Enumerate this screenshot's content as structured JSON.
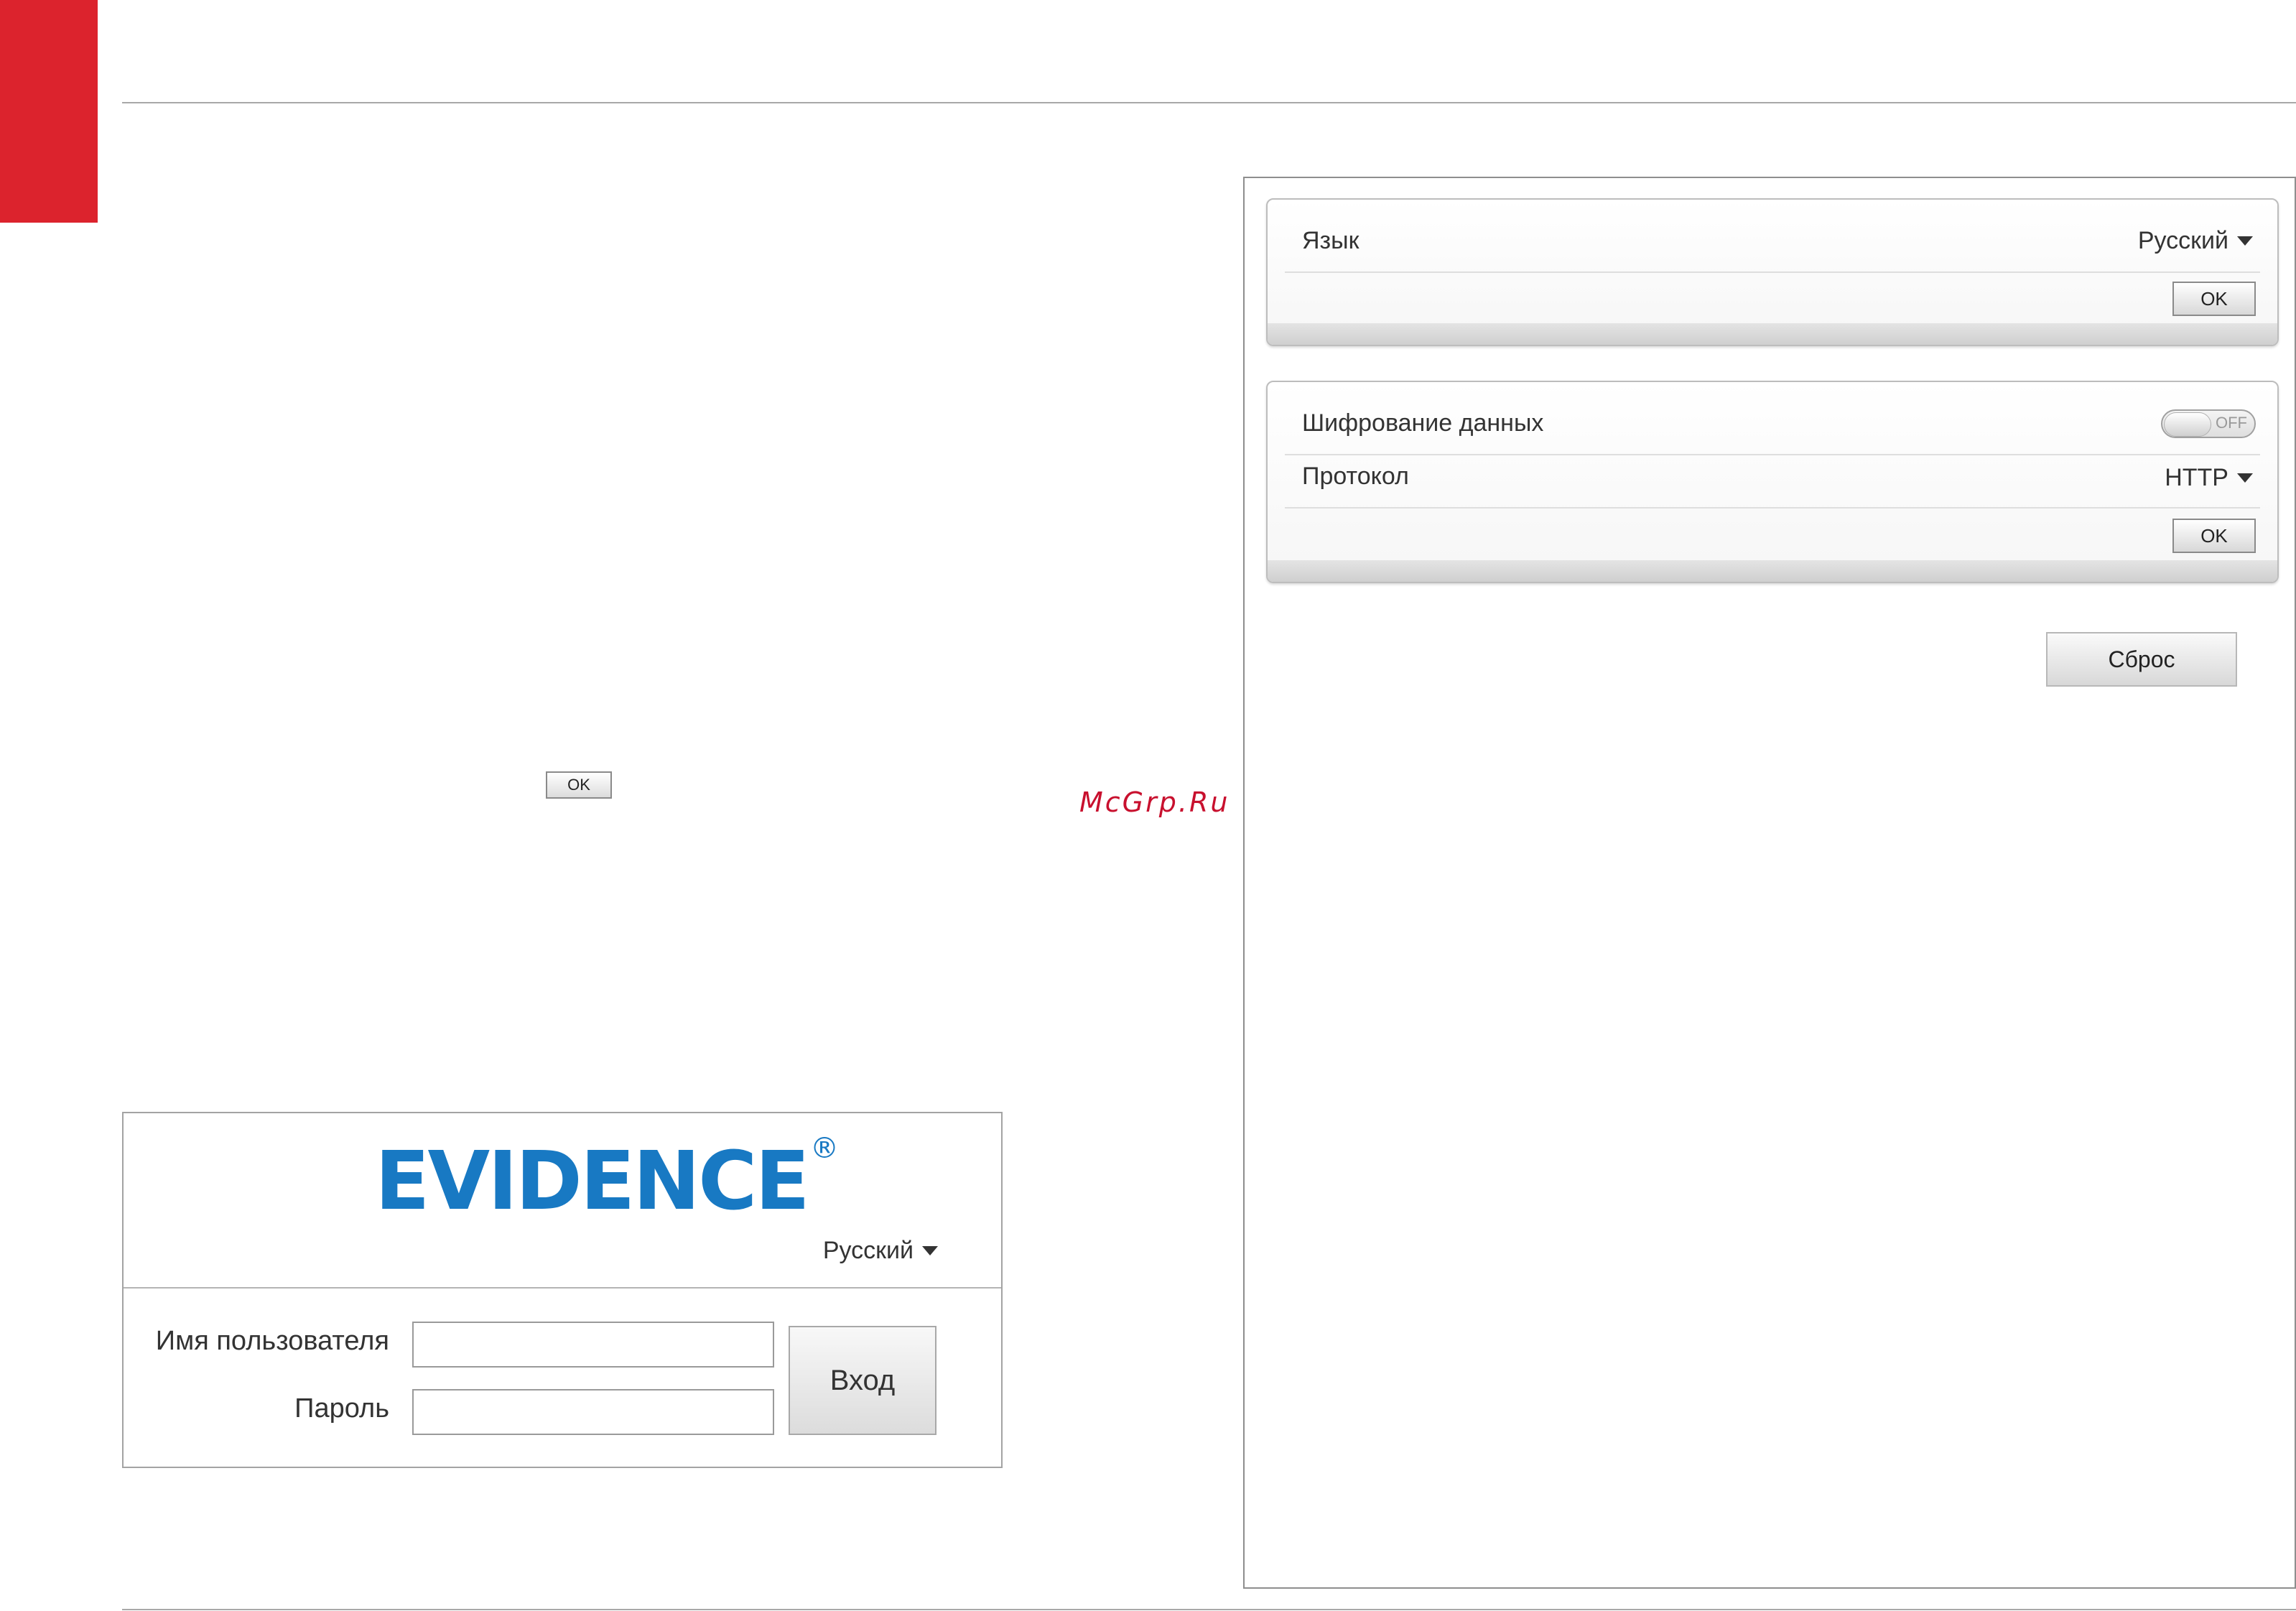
{
  "inline_ok_label": "OK",
  "watermark": "McGrp.Ru",
  "login": {
    "logo_text": "EVIDENCE",
    "logo_mark": "®",
    "language": "Русский",
    "username_label": "Имя пользователя",
    "username_value": "",
    "password_label": "Пароль",
    "password_value": "",
    "login_button": "Вход"
  },
  "settings": {
    "language_group": {
      "label": "Язык",
      "value": "Русский",
      "ok_label": "OK"
    },
    "security_group": {
      "encryption_label": "Шифрование данных",
      "encryption_state": "OFF",
      "protocol_label": "Протокол",
      "protocol_value": "HTTP",
      "ok_label": "OK"
    },
    "reset_label": "Сброс"
  },
  "colors": {
    "accent_red": "#dc232d",
    "logo_blue": "#1879c3",
    "watermark": "#c8102e"
  }
}
